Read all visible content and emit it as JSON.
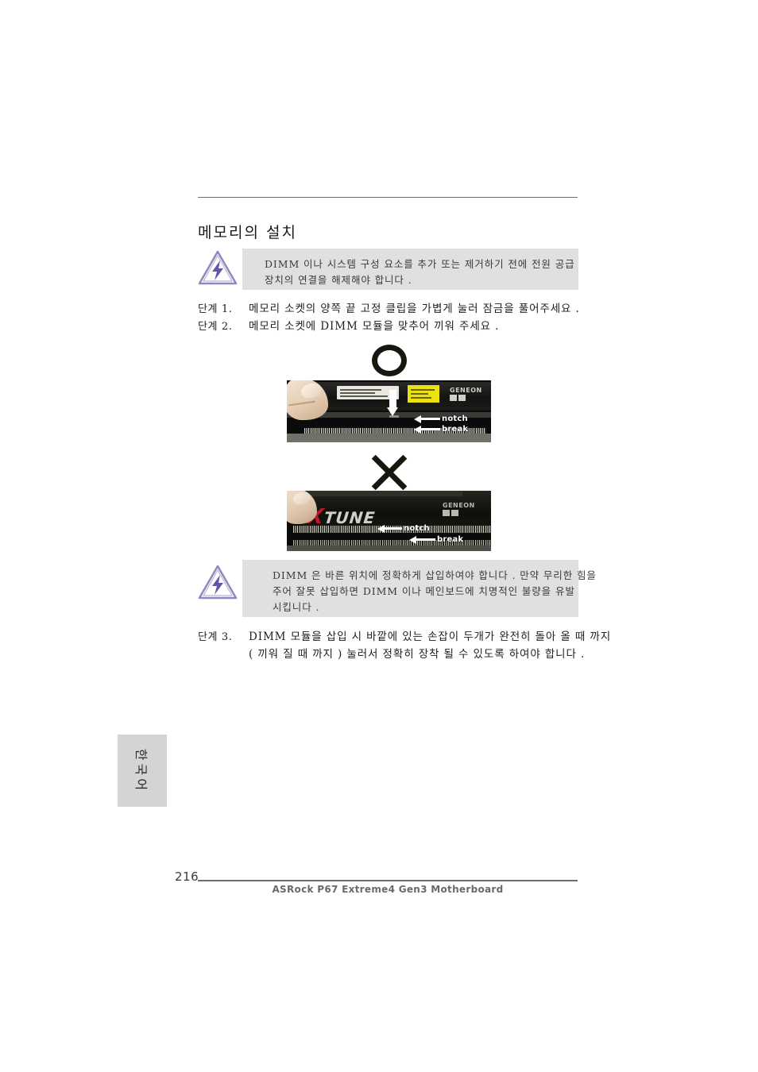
{
  "document": {
    "section_title": "메모리의 설치",
    "page_number": "216",
    "footer_text": "ASRock  P67 Extreme4 Gen3  Motherboard",
    "side_tab_text": "한국어"
  },
  "notes": [
    {
      "icon": "warning-triangle-lightning-icon",
      "lines": [
        "DIMM 이나 시스템 구성 요소를 추가 또는 제거하기 전에 전원 공급",
        "장치의 연결을 해제해야 합니다 ."
      ]
    },
    {
      "icon": "warning-triangle-lightning-icon",
      "lines": [
        "DIMM 은 바른 위치에 정확하게 삽입하여야 합니다 . 만약 무리한 힘을",
        "주어 잘못 삽입하면 DIMM 이나 메인보드에 치명적인 불량을 유발",
        "시킵니다 ."
      ]
    }
  ],
  "steps": [
    {
      "label": "단계 1.",
      "lines": [
        "메모리 소켓의 양쪽 끝 고정 클립을 가볍게 눌러 잠금을 풀어주세요 ."
      ]
    },
    {
      "label": "단계 2.",
      "lines": [
        "메모리 소켓에 DIMM 모듈을 맞추어 끼워 주세요 ."
      ]
    },
    {
      "label": "단계 3.",
      "lines": [
        "DIMM 모듈을 삽입 시 바깥에 있는 손잡이 두개가 완전히 돌아 올 때 까지",
        "( 끼워 질 때 까지 ) 눌러서 정확히 장착 될 수 있도록 하여야 합니다 ."
      ]
    }
  ],
  "figures": {
    "correct": {
      "mark": "circle-ok-mark",
      "brand_text": "GENEON",
      "callouts": [
        "notch",
        "break"
      ],
      "insert_arrow": "down-arrow-icon"
    },
    "wrong": {
      "mark": "cross-no-mark",
      "module_logo": "XTUNE",
      "module_logo_initial": "X",
      "module_logo_rest": "TUNE",
      "brand_text": "GENEON",
      "callouts": [
        "notch",
        "break"
      ]
    }
  },
  "colors": {
    "note_box_bg": "#e0e0e0",
    "side_tab_bg": "#d4d4d4",
    "rule": "#6e6e6e",
    "footer_text": "#6a6a6a",
    "warning_icon": "#6f6aa8",
    "mark_black": "#17160f",
    "label_yellow": "#ece20d",
    "logo_red": "#c0182a"
  }
}
